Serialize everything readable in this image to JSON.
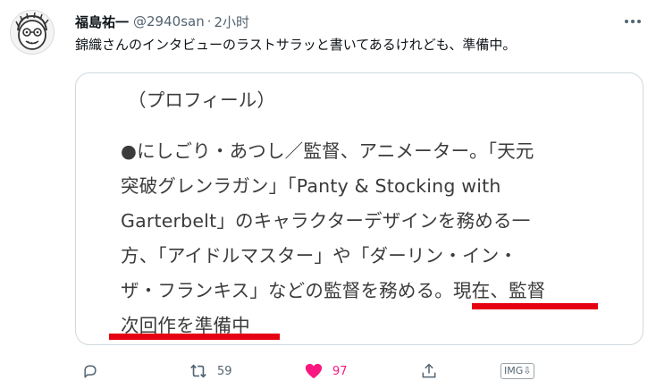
{
  "tweet": {
    "author_name": "福島祐一",
    "handle": "@2940san",
    "separator": "·",
    "time": "2小时",
    "text": "錦織さんのインタビューのラストサラッと書いてあるけれども、準備中。"
  },
  "media": {
    "lines": [
      "（プロフィール）",
      "●にしごり・あつし／監督、アニメーター。「天元",
      "突破グレンラガン」「Panty & Stocking with",
      "Garterbelt」のキャラクターデザインを務める一",
      "方、「アイドルマスター」や「ダーリン・イン・",
      "ザ・フランキス」などの監督を務める。現在、監督",
      "次回作を準備中"
    ],
    "highlight_color": "#e50012"
  },
  "actions": {
    "reply_icon": "reply-icon",
    "retweet_icon": "retweet-icon",
    "retweet_count": "59",
    "like_icon": "heart-icon",
    "like_count": "97",
    "share_icon": "share-icon",
    "img_save_label": "IMG⇩"
  },
  "colors": {
    "text": "#0f1419",
    "secondary": "#536471",
    "like": "#f91880",
    "border": "#cfd9de"
  }
}
